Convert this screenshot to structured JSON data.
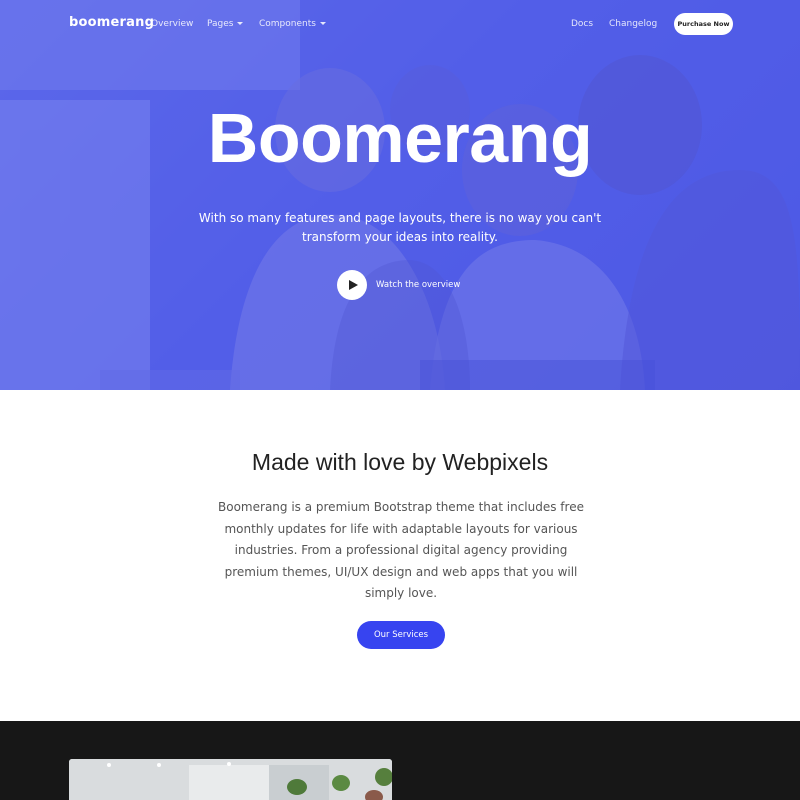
{
  "nav": {
    "logo": "boomerang",
    "overview": "Overview",
    "pages": "Pages",
    "components": "Components",
    "docs": "Docs",
    "changelog": "Changelog",
    "purchase": "Purchase Now"
  },
  "hero": {
    "title": "Boomerang",
    "subtitle": "With so many features and page layouts, there is no way you can't transform your ideas into reality.",
    "play_label": "Watch the overview"
  },
  "about": {
    "title": "Made with love by Webpixels",
    "text": "Boomerang is a premium Bootstrap theme that includes free monthly updates for life with adaptable layouts for various industries. From a professional digital agency providing premium themes, UI/UX design and web apps that you will simply love.",
    "button": "Our Services"
  },
  "colors": {
    "hero_overlay": "#4d58e6",
    "primary": "#3744f0",
    "dark_section": "#171717"
  }
}
